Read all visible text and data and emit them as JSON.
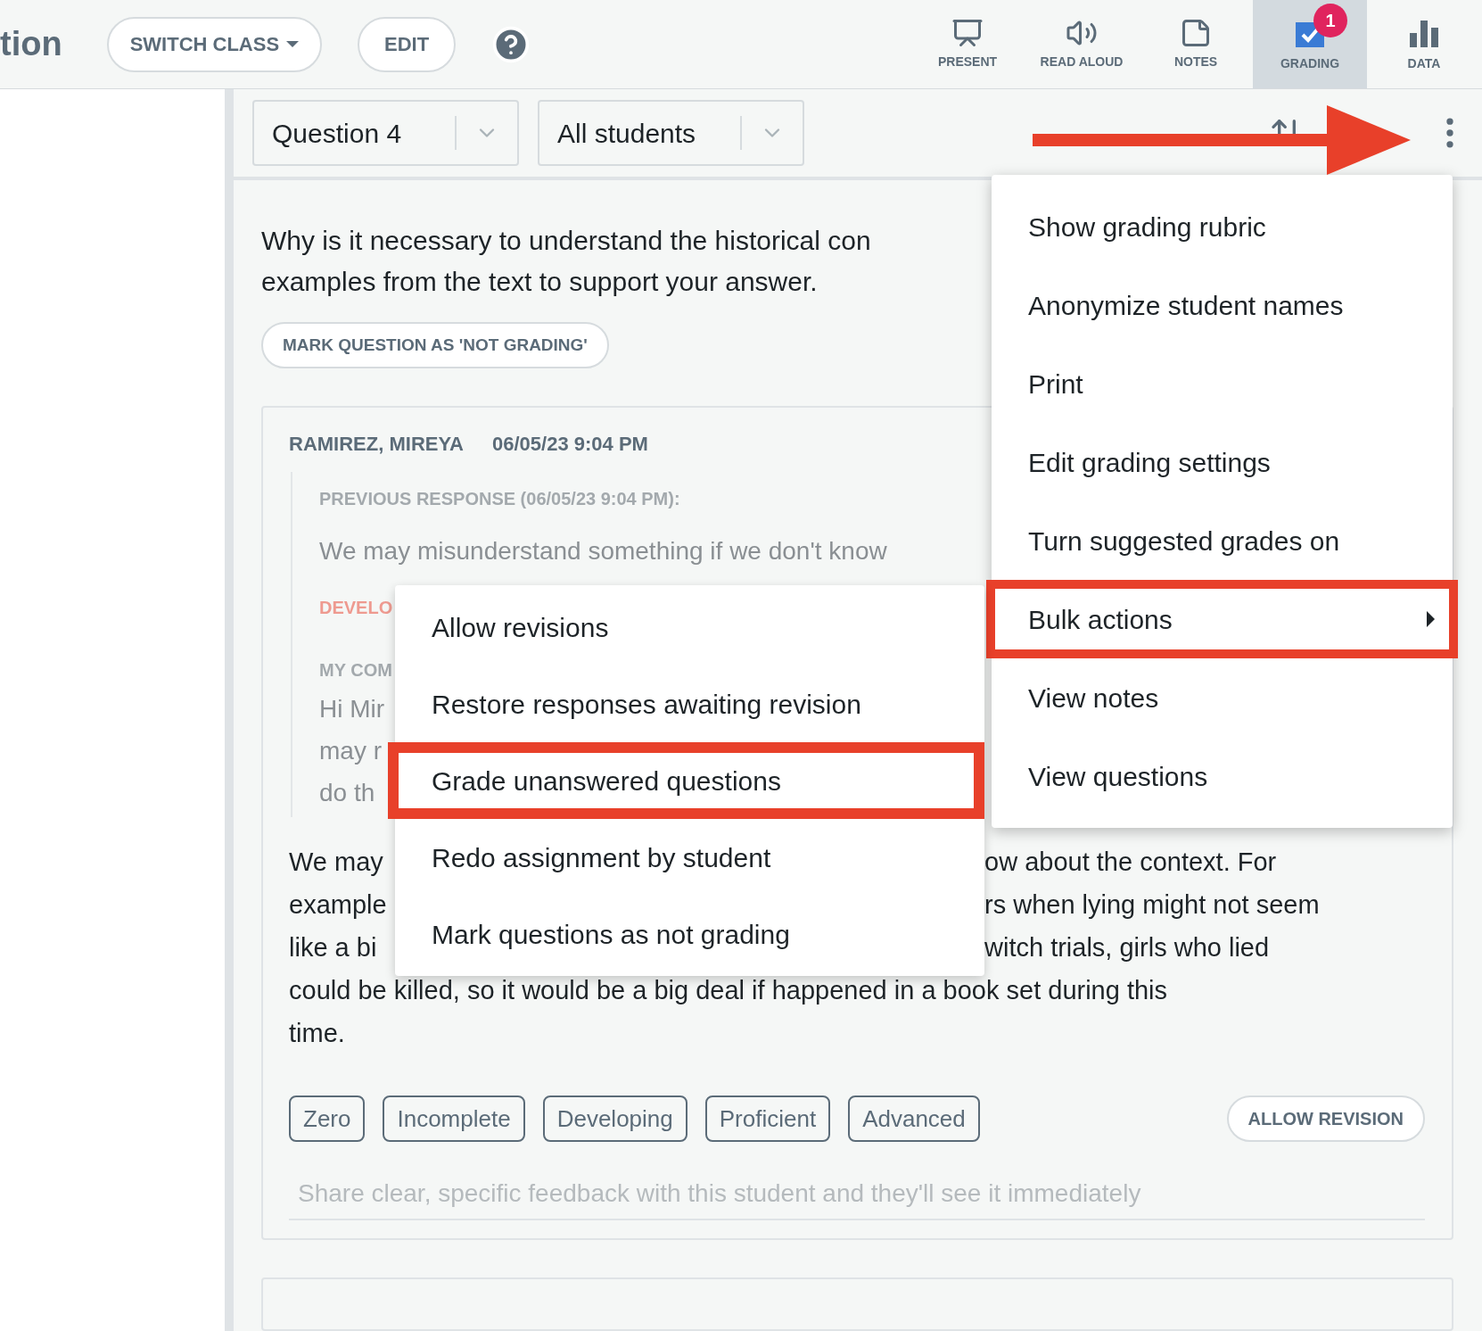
{
  "header": {
    "title": "tion",
    "switch_class": "SWITCH CLASS",
    "edit": "EDIT",
    "tools": [
      {
        "kind": "present",
        "label": "PRESENT",
        "selected": false
      },
      {
        "kind": "read",
        "label": "READ ALOUD",
        "selected": false
      },
      {
        "kind": "notes",
        "label": "NOTES",
        "selected": false
      },
      {
        "kind": "grading",
        "label": "GRADING",
        "selected": true,
        "badge": "1"
      },
      {
        "kind": "data",
        "label": "DATA",
        "selected": false
      }
    ]
  },
  "filters": [
    {
      "value": "Question 4"
    },
    {
      "value": "All students"
    }
  ],
  "question": {
    "lines": [
      "Why is it necessary to understand the historical con",
      "examples from the text to support your answer."
    ],
    "mark_button": "MARK QUESTION AS 'NOT GRADING'"
  },
  "response": {
    "student": "RAMIREZ, MIREYA",
    "time": "06/05/23 9:04 PM",
    "previous_heading": "PREVIOUS RESPONSE (06/05/23 9:04 PM):",
    "previous_text": "We may misunderstand something if we don't know",
    "previous_grade": "DEVELO",
    "comment_heading": "MY COM",
    "comment_lines": [
      "Hi Mir",
      "may r",
      "do th"
    ],
    "answer_lines": [
      {
        "left": "We may",
        "right": "ow about the context. For"
      },
      {
        "left": "example",
        "right": "rs when lying might not seem"
      },
      {
        "left": "like a bi",
        "right": "witch trials, girls who lied"
      },
      {
        "left": "could be killed, so it would be a big deal if happened in a book set during this"
      },
      {
        "left": "time."
      }
    ],
    "grades": [
      "Zero",
      "Incomplete",
      "Developing",
      "Proficient",
      "Advanced"
    ],
    "allow_revision": "ALLOW REVISION",
    "feedback": {
      "placeholder": "Share clear, specific feedback with this student and they'll see it immediately"
    }
  },
  "menu": {
    "items": [
      {
        "label": "Show grading rubric",
        "submenu": false,
        "annotated": false
      },
      {
        "label": "Anonymize student names",
        "submenu": false,
        "annotated": false
      },
      {
        "label": "Print",
        "submenu": false,
        "annotated": false
      },
      {
        "label": "Edit grading settings",
        "submenu": false,
        "annotated": false
      },
      {
        "label": "Turn suggested grades on",
        "submenu": false,
        "annotated": false
      },
      {
        "label": "Bulk actions",
        "submenu": true,
        "annotated": true
      },
      {
        "label": "View notes",
        "submenu": false,
        "annotated": false
      },
      {
        "label": "View questions",
        "submenu": false,
        "annotated": false
      }
    ]
  },
  "submenu": {
    "items": [
      {
        "label": "Allow revisions",
        "annotated": false
      },
      {
        "label": "Restore responses awaiting revision",
        "annotated": false
      },
      {
        "label": "Grade unanswered questions",
        "annotated": true
      },
      {
        "label": "Redo assignment by student",
        "annotated": false
      },
      {
        "label": "Mark questions as not grading",
        "annotated": false
      }
    ]
  }
}
